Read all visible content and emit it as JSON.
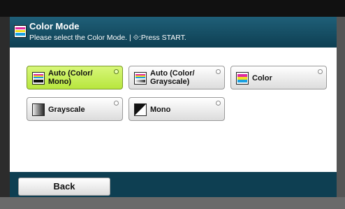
{
  "header": {
    "title": "Color Mode",
    "subtitle": "Please select the Color Mode. | ⟐:Press START.",
    "icon": "color-mode-icon"
  },
  "options": [
    {
      "label": "Auto (Color/\nMono)",
      "icon": "auto-color-mono-icon",
      "selected": true
    },
    {
      "label": "Auto (Color/\nGrayscale)",
      "icon": "auto-color-grayscale-icon",
      "selected": false
    },
    {
      "label": "Color",
      "icon": "color-icon",
      "selected": false
    },
    {
      "label": "Grayscale",
      "icon": "grayscale-icon",
      "selected": false
    },
    {
      "label": "Mono",
      "icon": "mono-icon",
      "selected": false
    }
  ],
  "footer": {
    "back_label": "Back"
  },
  "colors": {
    "header": "#0e3f52",
    "selected": "#c8ee5a"
  }
}
